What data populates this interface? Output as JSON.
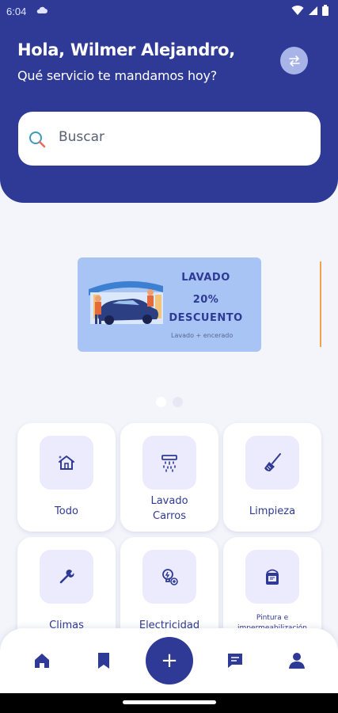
{
  "status_bar": {
    "time": "6:04"
  },
  "header": {
    "greeting": "Hola, Wilmer Alejandro,",
    "subtitle": "Qué servicio te mandamos hoy?"
  },
  "search": {
    "placeholder": "Buscar"
  },
  "banner": {
    "title": "LAVADO",
    "discount": "20%",
    "discount_word": "DESCUENTO",
    "caption": "Lavado + encerado"
  },
  "carousel": {
    "pages": 2,
    "active_index": 0
  },
  "categories": [
    {
      "label_1": "Todo",
      "label_2": "",
      "icon": "home-icon"
    },
    {
      "label_1": "Lavado",
      "label_2": "Carros",
      "icon": "shower-icon"
    },
    {
      "label_1": "Limpieza",
      "label_2": "",
      "icon": "broom-icon"
    },
    {
      "label_1": "Climas",
      "label_2": "",
      "icon": "wrench-icon"
    },
    {
      "label_1": "Electricidad",
      "label_2": "",
      "icon": "lightbulb-icon"
    },
    {
      "label_1": "Pintura e",
      "label_2": "impermeabilización",
      "icon": "paint-bucket-icon"
    }
  ],
  "bottom_nav": {
    "items": [
      "home-icon",
      "bookmark-icon",
      "add-icon",
      "chat-icon",
      "profile-icon"
    ],
    "fab_symbol": "+"
  },
  "colors": {
    "primary": "#2e3a96",
    "banner_bg": "#a8c4f4",
    "icon_bg": "#ecebfe",
    "page_bg": "#f4f5fb"
  }
}
